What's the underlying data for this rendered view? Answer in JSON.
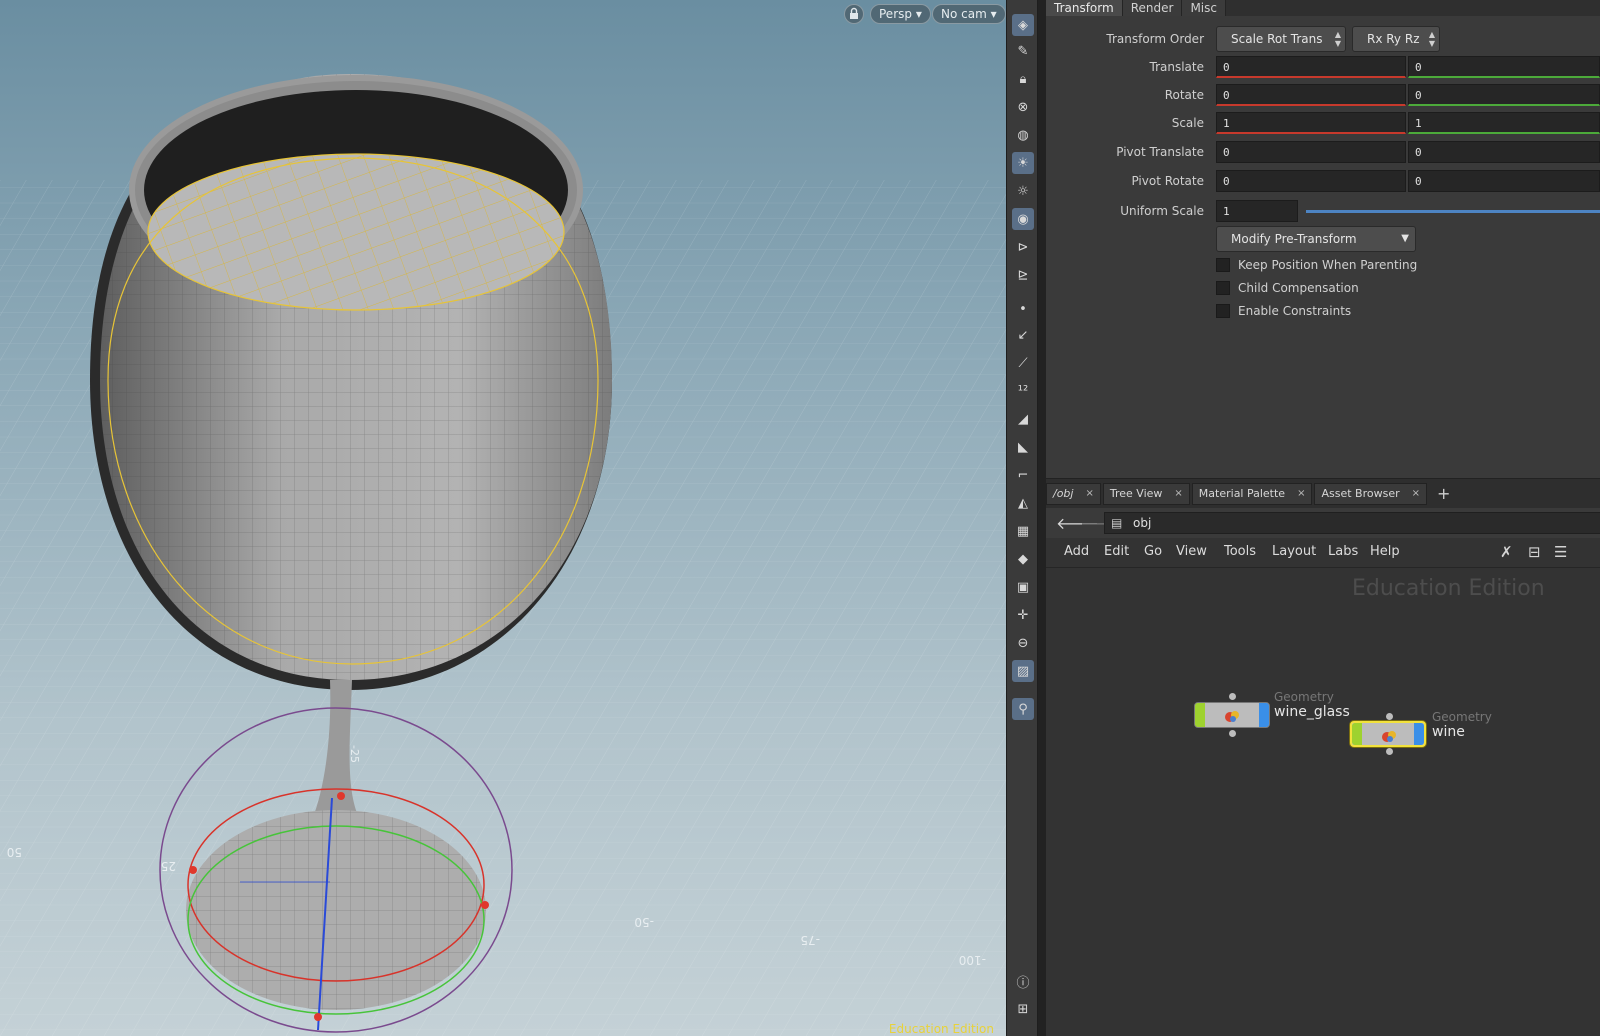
{
  "viewport": {
    "view_mode": "Persp",
    "camera": "No cam",
    "grid_labels": [
      "50",
      "25",
      "-25",
      "-50",
      "-75",
      "-100"
    ],
    "watermark": "Education Edition"
  },
  "toolbar": {
    "icons": [
      "select-icon",
      "lasso-icon",
      "lock-icon",
      "ghost-icon",
      "sphere-icon",
      "light-bulb-icon",
      "light-add-icon",
      "camera-icon",
      "camera-move-icon",
      "camera-follow-icon",
      "point-icon",
      "paint-icon",
      "brush-icon",
      "numbering-icon",
      "paint-bucket-icon",
      "shelf-12-icon",
      "curve-icon",
      "sculpt-icon",
      "checker-icon",
      "uv-icon",
      "texture-icon",
      "snap-icon",
      "disk-icon",
      "image-icon",
      "pin-icon",
      "info-icon",
      "grid-icon"
    ]
  },
  "params": {
    "tabs": [
      "Transform",
      "Render",
      "Misc"
    ],
    "active_tab": "Transform",
    "transform_order": {
      "label": "Transform Order",
      "value": "Scale Rot Trans",
      "rot_order": "Rx Ry Rz"
    },
    "translate": {
      "label": "Translate",
      "x": "0",
      "y": "0"
    },
    "rotate": {
      "label": "Rotate",
      "x": "0",
      "y": "0"
    },
    "scale": {
      "label": "Scale",
      "x": "1",
      "y": "1"
    },
    "pivot_translate": {
      "label": "Pivot Translate",
      "x": "0",
      "y": "0"
    },
    "pivot_rotate": {
      "label": "Pivot Rotate",
      "x": "0",
      "y": "0"
    },
    "uniform_scale": {
      "label": "Uniform Scale",
      "value": "1"
    },
    "pre_transform_menu": "Modify Pre-Transform",
    "checkboxes": [
      "Keep Position When Parenting",
      "Child Compensation",
      "Enable Constraints"
    ]
  },
  "network": {
    "tabs": [
      {
        "label": "/obj"
      },
      {
        "label": "Tree View"
      },
      {
        "label": "Material Palette"
      },
      {
        "label": "Asset Browser"
      }
    ],
    "path": "obj",
    "menus": [
      "Add",
      "Edit",
      "Go",
      "View",
      "Tools",
      "Layout",
      "Labs",
      "Help"
    ],
    "watermark": "Education Edition",
    "nodes": [
      {
        "type": "Geometry",
        "name": "wine_glass",
        "selected": false
      },
      {
        "type": "Geometry",
        "name": "wine",
        "selected": true
      }
    ]
  },
  "colors": {
    "x_axis": "#c7392c",
    "y_axis": "#4caa3a",
    "node_selected": "#f2e23c",
    "node_left": "#9ed22f",
    "node_right": "#3a8fe8"
  }
}
